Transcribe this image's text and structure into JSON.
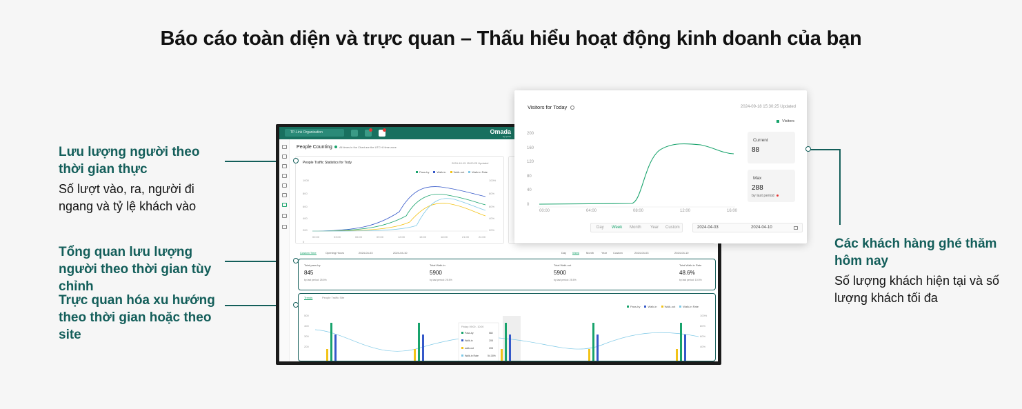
{
  "headline": "Báo cáo toàn diện và trực quan – Thấu hiểu hoạt động kinh doanh của bạn",
  "callouts": {
    "realtime": {
      "title": "Lưu lượng người theo thời gian thực",
      "desc": "Số lượt vào, ra, người đi ngang và tỷ lệ khách vào"
    },
    "custom": {
      "title": "Tổng quan lưu lượng người theo thời gian tùy chỉnh"
    },
    "trend": {
      "title": "Trực quan hóa xu hướng theo thời gian hoặc theo site"
    },
    "today": {
      "title": "Các khách hàng ghé thăm hôm nay",
      "desc": "Số lượng khách hiện tại và số lượng khách tối đa"
    }
  },
  "app": {
    "org": "TP-Link Organization",
    "brand": "Omada",
    "brand_sub": "by tp-link",
    "page_title": "People Counting",
    "page_note": "All times in the Chart are the UTC+8 time zone",
    "traffic_title": "People Traffic Statistics for Tody",
    "traffic_updated": "2024-10-15 15:00:25 Updated",
    "legend": [
      "Pass-by",
      "Walk-in",
      "Walk-out",
      "Walk-in Rate"
    ],
    "x_ticks": [
      "00:00",
      "03:00",
      "06:00",
      "09:00",
      "12:00",
      "15:00",
      "18:00",
      "21:00",
      "24:00"
    ],
    "y_ticks": [
      "1000",
      "800",
      "600",
      "400",
      "200",
      "0"
    ],
    "y2_ticks": [
      "100%",
      "80%",
      "60%",
      "40%",
      "20%",
      "0%"
    ],
    "filter": {
      "tab1": "Custom Time",
      "tab2": "Opening Hours",
      "from": "2024-04-03",
      "to": "2024-04-10",
      "periods": [
        "Day",
        "Week",
        "Month",
        "Year",
        "Custom"
      ],
      "from2": "2024-04-03",
      "to2": "2024-04-10"
    },
    "stats": [
      {
        "label": "Total pass-by",
        "value": "845",
        "period": "by last period: 25.5%"
      },
      {
        "label": "Total Walk-in",
        "value": "5900",
        "period": "by last period: 25.5%"
      },
      {
        "label": "Total Walk-out",
        "value": "5900",
        "period": "by last period: 25.5%"
      },
      {
        "label": "Total Walk-in Rate",
        "value": "48.6%",
        "period": "by last period: 10.5%"
      }
    ],
    "trends_tab": "Trends",
    "site_tab": "People Traffic Site",
    "trend_y": [
      "500",
      "400",
      "300",
      "200"
    ],
    "trend_y2": [
      "100%",
      "80%",
      "60%",
      "40%"
    ],
    "tooltip": {
      "title": "Friday: 09:00 - 10:00",
      "rows": [
        {
          "label": "Pass-by",
          "value": "582"
        },
        {
          "label": "Walk-in",
          "value": "208"
        },
        {
          "label": "walk-out",
          "value": "208"
        },
        {
          "label": "Walk-in Rate",
          "value": "54.18%"
        }
      ]
    }
  },
  "popup": {
    "title": "Visitors for Today",
    "updated": "2024-09-18 15:30:25 Updated",
    "legend": "Visitors",
    "y_ticks": [
      "200",
      "160",
      "120",
      "80",
      "40",
      "0"
    ],
    "x_ticks": [
      "00:00",
      "04:00",
      "08:00",
      "12:00",
      "16:00"
    ],
    "current_label": "Current",
    "current_value": "88",
    "max_label": "Max",
    "max_value": "288",
    "max_period": "by last period",
    "periods": [
      "Day",
      "Week",
      "Month",
      "Year",
      "Custom"
    ],
    "date_from": "2024-04-03",
    "date_to": "2024-04-10"
  },
  "colors": {
    "accent": "#135e5a",
    "passby": "#18a36c",
    "walkin": "#3558c9",
    "walkout": "#f2c318",
    "rate": "#7cc8e6"
  }
}
